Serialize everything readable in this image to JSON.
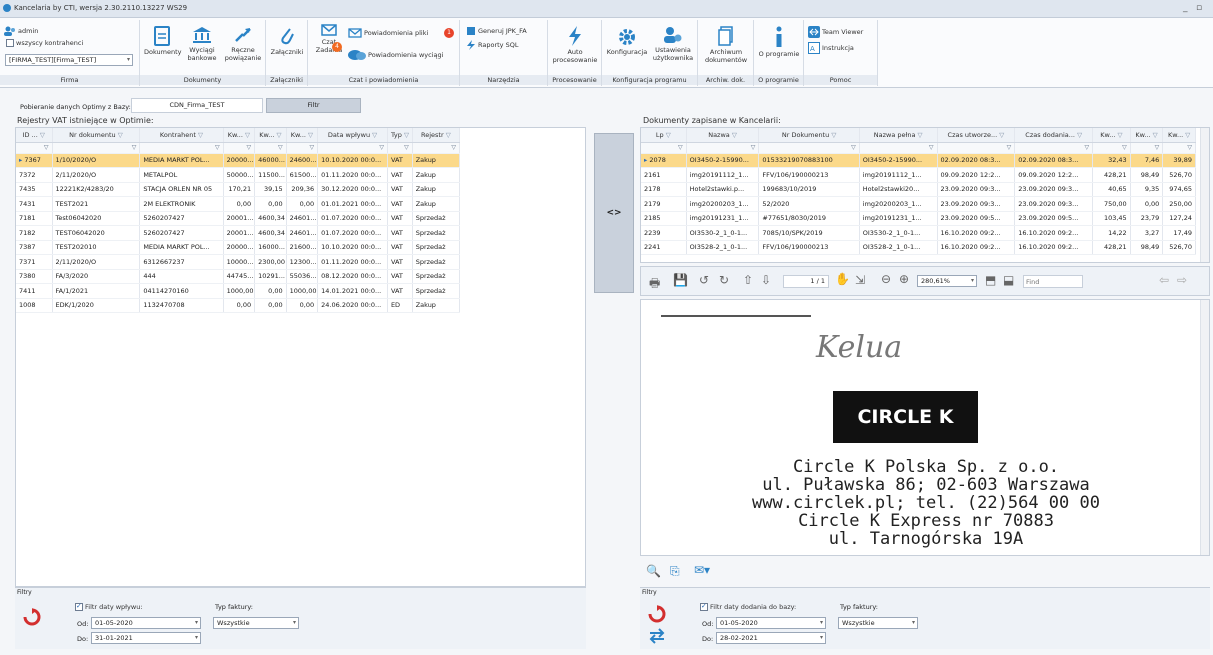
{
  "app": {
    "title": "Kancelaria by CTI, wersja 2.30.2110.13227 WS29"
  },
  "ribbon": {
    "user": "admin",
    "all_contractors": "wszyscy kontrahenci",
    "company_value": "[FIRMA_TEST][Firma_TEST]",
    "groups": {
      "firma": "Firma",
      "dokumenty": "Dokumenty",
      "zalaczniki": "Załączniki",
      "czat": "Czat i powiadomienia",
      "narzedzia": "Narzędzia",
      "procesowanie": "Procesowanie",
      "konfiguracja": "Konfiguracja programu",
      "archiw": "Archiw. dok.",
      "oprogramie": "O programie",
      "pomoc": "Pomoc"
    },
    "buttons": {
      "dokumenty": "Dokumenty",
      "wyciagi": "Wyciągi bankowe",
      "reczne": "Ręczne powiązanie",
      "zalaczniki": "Załączniki",
      "czat": "Czat",
      "zadania": "Zadania",
      "powiadomienia_pliki": "Powiadomienia pliki",
      "powiadomienia_wyciagi": "Powiadomienia wyciągi",
      "jpk": "Generuj JPK_FA",
      "raporty": "Raporty SQL",
      "auto": "Auto procesowanie",
      "konfiguracja": "Konfiguracja",
      "ustawienia": "Ustawienia użytkownika",
      "archiwum": "Archiwum dokumentów",
      "oprogramie": "O programie",
      "teamviewer": "Team Viewer",
      "instrukcja": "Instrukcja"
    },
    "badges": {
      "powiadomienia": "1",
      "zadania": "4"
    }
  },
  "left": {
    "source_label": "Pobieranie danych Optimy z Bazy:",
    "source_value": "CDN_Firma_TEST",
    "filter_button": "Filtr",
    "title": "Rejestry VAT istniejące w Optimie:",
    "columns": [
      "ID ...",
      "Nr dokumentu",
      "Kontrahent",
      "Kw...",
      "Kw...",
      "Kw...",
      "Data wpływu",
      "Typ",
      "Rejestr"
    ],
    "rows": [
      [
        "7367",
        "1/10/2020/O",
        "MEDIA MARKT POL...",
        "20000...",
        "46000...",
        "24600...",
        "10.10.2020 00:0...",
        "VAT",
        "Zakup"
      ],
      [
        "7372",
        "2/11/2020/O",
        "METALPOL",
        "50000...",
        "11500...",
        "61500...",
        "01.11.2020 00:0...",
        "VAT",
        "Zakup"
      ],
      [
        "7435",
        "12221K2/4283/20",
        "STACJA ORLEN NR 05",
        "170,21",
        "39,15",
        "209,36",
        "30.12.2020 00:0...",
        "VAT",
        "Zakup"
      ],
      [
        "7431",
        "TEST2021",
        "2M ELEKTRONIK",
        "0,00",
        "0,00",
        "0,00",
        "01.01.2021 00:0...",
        "VAT",
        "Zakup"
      ],
      [
        "7181",
        "Test06042020",
        "5260207427",
        "20001...",
        "4600,34",
        "24601...",
        "01.07.2020 00:0...",
        "VAT",
        "Sprzedaż"
      ],
      [
        "7182",
        "TEST06042020",
        "5260207427",
        "20001...",
        "4600,34",
        "24601...",
        "01.07.2020 00:0...",
        "VAT",
        "Sprzedaż"
      ],
      [
        "7387",
        "TEST202010",
        "MEDIA MARKT POL...",
        "20000...",
        "16000...",
        "21600...",
        "10.10.2020 00:0...",
        "VAT",
        "Sprzedaż"
      ],
      [
        "7371",
        "2/11/2020/O",
        "6312667237",
        "10000...",
        "2300,00",
        "12300...",
        "01.11.2020 00:0...",
        "VAT",
        "Sprzedaż"
      ],
      [
        "7380",
        "FA/3/2020",
        "444",
        "44745...",
        "10291...",
        "55036...",
        "08.12.2020 00:0...",
        "VAT",
        "Sprzedaż"
      ],
      [
        "7411",
        "FA/1/2021",
        "04114270160",
        "1000,00",
        "0,00",
        "1000,00",
        "14.01.2021 00:0...",
        "VAT",
        "Sprzedaż"
      ],
      [
        "1008",
        "EDK/1/2020",
        "1132470708",
        "0,00",
        "0,00",
        "0,00",
        "24.06.2020 00:0...",
        "ED",
        "Zakup"
      ]
    ],
    "filters": {
      "header": "Filtry",
      "date_check": "Filtr daty wpływu:",
      "from_label": "Od:",
      "from_value": "01-05-2020",
      "to_label": "Do:",
      "to_value": "31-01-2021",
      "type_label": "Typ faktury:",
      "type_value": "Wszystkie"
    }
  },
  "middle": {
    "button": "<>"
  },
  "right": {
    "title": "Dokumenty zapisane w Kancelarii:",
    "columns": [
      "Lp",
      "Nazwa",
      "Nr Dokumentu",
      "Nazwa pełna",
      "Czas utworze...",
      "Czas dodania...",
      "Kw...",
      "Kw...",
      "Kw..."
    ],
    "rows": [
      [
        "2078",
        "OI3450-2-15990...",
        "01533219070883100",
        "OI3450-2-15990...",
        "02.09.2020 08:3...",
        "02.09.2020 08:3...",
        "32,43",
        "7,46",
        "39,89"
      ],
      [
        "2161",
        "img20191112_1...",
        "FFV/106/190000213",
        "img20191112_1...",
        "09.09.2020 12:2...",
        "09.09.2020 12:2...",
        "428,21",
        "98,49",
        "526,70"
      ],
      [
        "2178",
        "Hotel2stawki.p...",
        "199683/10/2019",
        "Hotel2stawki20...",
        "23.09.2020 09:3...",
        "23.09.2020 09:3...",
        "40,65",
        "9,35",
        "974,65"
      ],
      [
        "2179",
        "img20200203_1...",
        "52/2020",
        "img20200203_1...",
        "23.09.2020 09:3...",
        "23.09.2020 09:3...",
        "750,00",
        "0,00",
        "250,00"
      ],
      [
        "2185",
        "img20191231_1...",
        "#77651/8030/2019",
        "img20191231_1...",
        "23.09.2020 09:5...",
        "23.09.2020 09:5...",
        "103,45",
        "23,79",
        "127,24"
      ],
      [
        "2239",
        "OI3530-2_1_0-1...",
        "7085/10/SPK/2019",
        "OI3530-2_1_0-1...",
        "16.10.2020 09:2...",
        "16.10.2020 09:2...",
        "14,22",
        "3,27",
        "17,49"
      ],
      [
        "2241",
        "OI3528-2_1_0-1...",
        "FFV/106/190000213",
        "OI3528-2_1_0-1...",
        "16.10.2020 09:2...",
        "16.10.2020 09:2...",
        "428,21",
        "98,49",
        "526,70"
      ]
    ],
    "viewer": {
      "page": "1 / 1",
      "zoom": "280,61%",
      "find_placeholder": "Find"
    },
    "doc": {
      "signature": "Kelua",
      "brand": "CIRCLE K",
      "lines": [
        "Circle K Polska Sp. z o.o.",
        "ul. Puławska 86; 02-603 Warszawa",
        "www.circlek.pl; tel. (22)564 00 00",
        "Circle K Express nr 70883",
        "ul. Tarnogórska 19A"
      ]
    },
    "filters": {
      "header": "Filtry",
      "date_check": "Filtr daty dodania do bazy:",
      "from_label": "Od:",
      "from_value": "01-05-2020",
      "to_label": "Do:",
      "to_value": "28-02-2021",
      "type_label": "Typ faktury:",
      "type_value": "Wszystkie"
    }
  },
  "colors": {
    "accent": "#2b83c6",
    "selected_row": "#fbd98a",
    "badge": "#f26a21",
    "refresh": "#d32f2f"
  }
}
